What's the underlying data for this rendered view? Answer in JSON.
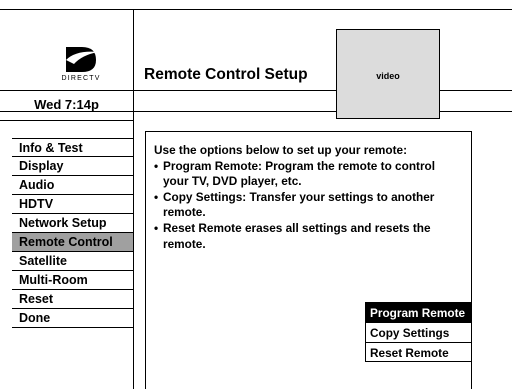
{
  "logo": {
    "text": "DIRECTV"
  },
  "status": {
    "time": "Wed 7:14p"
  },
  "header": {
    "title": "Remote Control Setup"
  },
  "video": {
    "label": "video"
  },
  "menu": {
    "items": [
      {
        "label": "Info & Test",
        "selected": false
      },
      {
        "label": "Display",
        "selected": false
      },
      {
        "label": "Audio",
        "selected": false
      },
      {
        "label": "HDTV",
        "selected": false
      },
      {
        "label": "Network Setup",
        "selected": false
      },
      {
        "label": "Remote Control",
        "selected": true
      },
      {
        "label": "Satellite",
        "selected": false
      },
      {
        "label": "Multi-Room",
        "selected": false
      },
      {
        "label": "Reset",
        "selected": false
      },
      {
        "label": "Done",
        "selected": false
      }
    ]
  },
  "content": {
    "intro": "Use the options below to set up your remote:",
    "bullets": [
      "Program Remote: Program the remote to control your TV, DVD player, etc.",
      "Copy Settings: Transfer your settings to another remote.",
      "Reset Remote erases all settings and resets the remote."
    ],
    "bullet_symbol": "•"
  },
  "options": [
    {
      "label": "Program Remote",
      "selected": true
    },
    {
      "label": "Copy Settings",
      "selected": false
    },
    {
      "label": "Reset Remote",
      "selected": false
    }
  ]
}
